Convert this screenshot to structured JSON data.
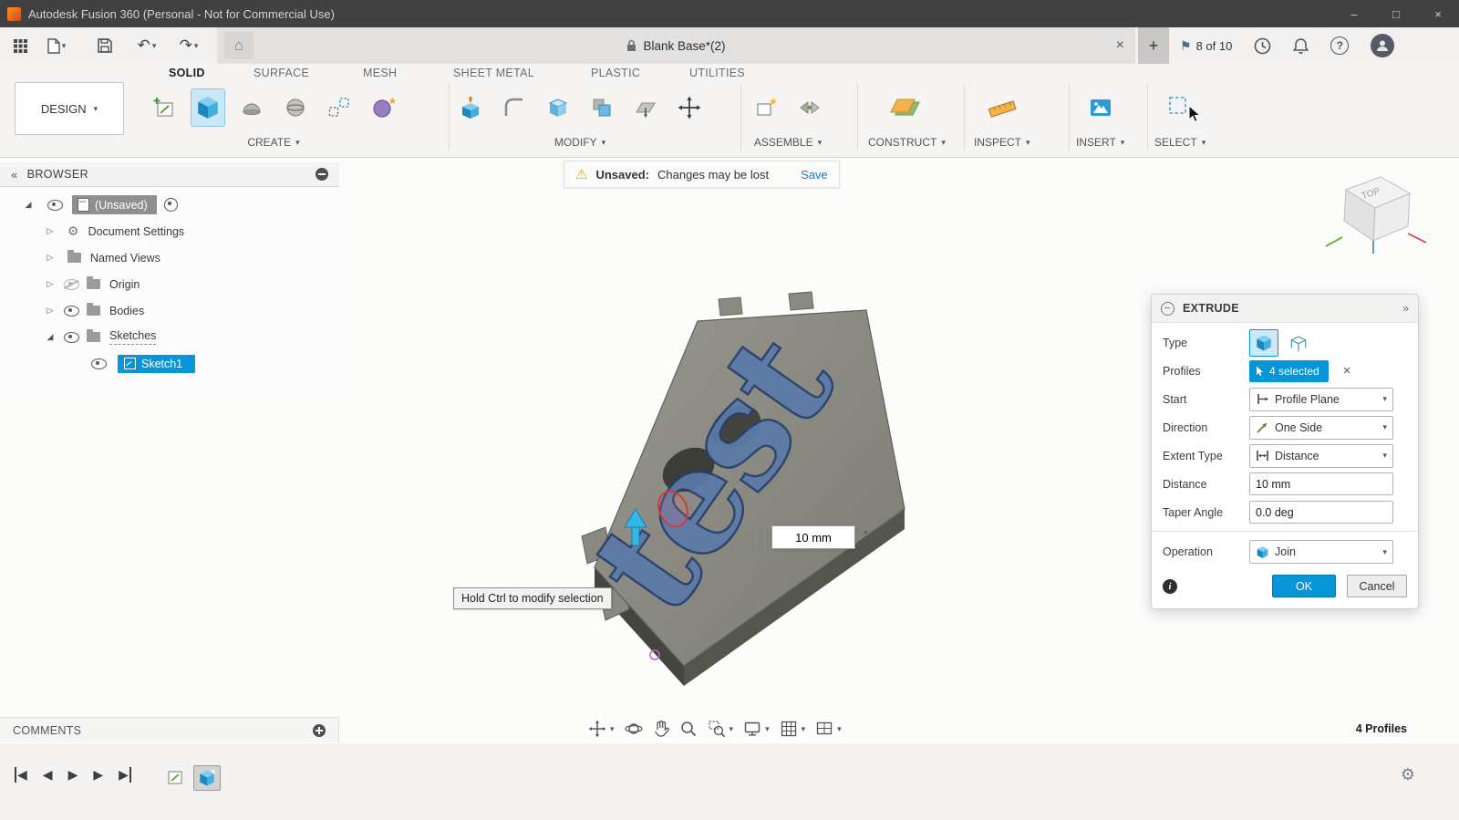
{
  "titlebar": {
    "title": "Autodesk Fusion 360 (Personal - Not for Commercial Use)"
  },
  "tabbar": {
    "document_title": "Blank Base*(2)",
    "quota": "8 of 10"
  },
  "ribbon": {
    "design": "DESIGN",
    "tabs": [
      "SOLID",
      "SURFACE",
      "MESH",
      "SHEET METAL",
      "PLASTIC",
      "UTILITIES"
    ],
    "groups": {
      "create": "CREATE",
      "modify": "MODIFY",
      "assemble": "ASSEMBLE",
      "construct": "CONSTRUCT",
      "inspect": "INSPECT",
      "insert": "INSERT",
      "select": "SELECT"
    }
  },
  "browser": {
    "title": "BROWSER",
    "root": "(Unsaved)",
    "items": [
      "Document Settings",
      "Named Views",
      "Origin",
      "Bodies",
      "Sketches"
    ],
    "sketch": "Sketch1"
  },
  "warning": {
    "label": "Unsaved:",
    "message": "Changes may be lost",
    "action": "Save"
  },
  "viewcube": {
    "top": "TOP"
  },
  "canvas": {
    "tooltip": "Hold Ctrl to modify selection",
    "dimension": "10 mm",
    "model_text": "test"
  },
  "extrude": {
    "title": "EXTRUDE",
    "fields": {
      "type": "Type",
      "profiles": "Profiles",
      "profiles_value": "4 selected",
      "start": "Start",
      "start_value": "Profile Plane",
      "direction": "Direction",
      "direction_value": "One Side",
      "extent_type": "Extent Type",
      "extent_value": "Distance",
      "distance": "Distance",
      "distance_value": "10 mm",
      "taper": "Taper Angle",
      "taper_value": "0.0 deg",
      "operation": "Operation",
      "operation_value": "Join"
    },
    "ok": "OK",
    "cancel": "Cancel"
  },
  "bottom": {
    "comments": "COMMENTS",
    "profiles_count": "4 Profiles"
  },
  "colors": {
    "accent": "#0696d7",
    "warning_icon": "#f0a202",
    "ok_button": "#0696d7"
  },
  "icons": {
    "caret_down": "▾",
    "warning": "⚠",
    "gear": "⚙",
    "home": "⌂",
    "undo": "↶",
    "redo": "↷",
    "close": "×",
    "minimize": "–",
    "maximize": "□",
    "plus": "+",
    "collapse_left": "«",
    "expand_right": "»",
    "tree_collapsed": "▷",
    "tree_expanded": "◢",
    "flag": "⚑",
    "question": "?",
    "info": "i",
    "tri_left": "◀",
    "tri_right": "▶"
  }
}
